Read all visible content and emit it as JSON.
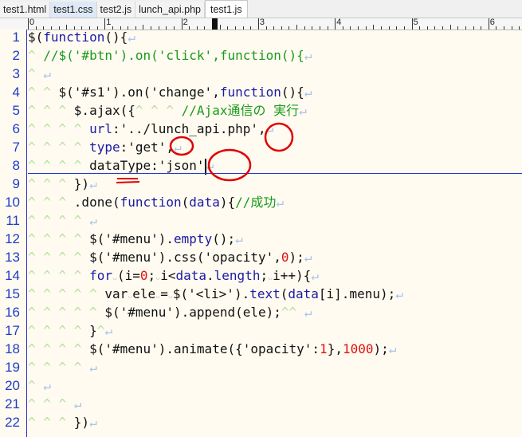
{
  "tabs": [
    {
      "label": "test1.html",
      "state": "normal"
    },
    {
      "label": "test1.css",
      "state": "hl"
    },
    {
      "label": "test2.js",
      "state": "normal"
    },
    {
      "label": "lunch_api.php",
      "state": "normal"
    },
    {
      "label": "test1.js",
      "state": "active"
    }
  ],
  "ruler": {
    "labels": [
      "0",
      "1",
      "2",
      "3",
      "4",
      "5",
      "6"
    ],
    "cursor_column": 24
  },
  "annotation_color": "#e00000",
  "lines": [
    [
      [
        "",
        "$("
      ],
      [
        "k",
        "function"
      ],
      [
        "",
        "(){"
      ],
      [
        "e",
        "↵"
      ]
    ],
    [
      [
        "t",
        "^ "
      ],
      [
        "c",
        "//$('#btn').on('click',function(){"
      ],
      [
        "e",
        "↵"
      ]
    ],
    [
      [
        "t",
        "^ "
      ],
      [
        "e",
        "↵"
      ]
    ],
    [
      [
        "t",
        "^ ^ "
      ],
      [
        "",
        "$('#s1').on('change',"
      ],
      [
        "k",
        "function"
      ],
      [
        "",
        "(){"
      ],
      [
        "e",
        "↵"
      ]
    ],
    [
      [
        "t",
        "^ ^ ^ "
      ],
      [
        "",
        "$.ajax({"
      ],
      [
        "t",
        "^ ^ ^ "
      ],
      [
        "c",
        "//Ajax通信の 実行"
      ],
      [
        "e",
        "↵"
      ]
    ],
    [
      [
        "t",
        "^ ^ ^ ^ "
      ],
      [
        "k",
        "url"
      ],
      [
        "",
        ":'../lunch_api.php',"
      ],
      [
        "e",
        "↵"
      ]
    ],
    [
      [
        "t",
        "^ ^ ^ ^ "
      ],
      [
        "k",
        "type"
      ],
      [
        "",
        ":'get',"
      ],
      [
        "e",
        "↵"
      ]
    ],
    [
      [
        "t",
        "^ ^ ^ ^ "
      ],
      [
        "",
        "dataType:'json'"
      ],
      [
        "cur",
        ""
      ],
      [
        "e",
        "↵"
      ]
    ],
    [
      [
        "t",
        "^ ^ ^ "
      ],
      [
        "",
        "})"
      ],
      [
        "e",
        "↵"
      ]
    ],
    [
      [
        "t",
        "^ ^ ^ "
      ],
      [
        "",
        ".done("
      ],
      [
        "k",
        "function"
      ],
      [
        "",
        "("
      ],
      [
        "k",
        "data"
      ],
      [
        "",
        "){"
      ],
      [
        "c",
        "//成功"
      ],
      [
        "e",
        "↵"
      ]
    ],
    [
      [
        "t",
        "^ ^ ^ ^ "
      ],
      [
        "e",
        "↵"
      ]
    ],
    [
      [
        "t",
        "^ ^ ^ ^ "
      ],
      [
        "",
        "$('#menu')."
      ],
      [
        "k",
        "empty"
      ],
      [
        "",
        "();"
      ],
      [
        "e",
        "↵"
      ]
    ],
    [
      [
        "t",
        "^ ^ ^ ^ "
      ],
      [
        "",
        "$('#menu').css('opacity',"
      ],
      [
        "n",
        "0"
      ],
      [
        "",
        ");"
      ],
      [
        "e",
        "↵"
      ]
    ],
    [
      [
        "t",
        "^ ^ ^ ^ "
      ],
      [
        "k",
        "for"
      ],
      [
        "s",
        "ᴗ"
      ],
      [
        "",
        "(i="
      ],
      [
        "n",
        "0"
      ],
      [
        "",
        ";"
      ],
      [
        "s",
        "ᴗ"
      ],
      [
        "",
        "i<"
      ],
      [
        "k",
        "data"
      ],
      [
        "",
        "."
      ],
      [
        "k",
        "length"
      ],
      [
        "",
        ";"
      ],
      [
        "s",
        "ᴗ"
      ],
      [
        "",
        "i++){"
      ],
      [
        "e",
        "↵"
      ]
    ],
    [
      [
        "t",
        "^ ^ ^ ^ ^ "
      ],
      [
        "",
        "var"
      ],
      [
        "s",
        "ᴗ"
      ],
      [
        "",
        "ele"
      ],
      [
        "s",
        "ᴗ"
      ],
      [
        "",
        "="
      ],
      [
        "s",
        "ᴗ"
      ],
      [
        "",
        "$('<li>')."
      ],
      [
        "k",
        "text"
      ],
      [
        "",
        "("
      ],
      [
        "k",
        "data"
      ],
      [
        "",
        "[i].menu);"
      ],
      [
        "e",
        "↵"
      ]
    ],
    [
      [
        "t",
        "^ ^ ^ ^ ^ "
      ],
      [
        "",
        "$('#menu').append(ele);"
      ],
      [
        "t",
        "^^ "
      ],
      [
        "e",
        "↵"
      ]
    ],
    [
      [
        "t",
        "^ ^ ^ ^ "
      ],
      [
        "",
        "}"
      ],
      [
        "t",
        "^"
      ],
      [
        "e",
        "↵"
      ]
    ],
    [
      [
        "t",
        "^ ^ ^ ^ "
      ],
      [
        "",
        "$('#menu').animate({'opacity':"
      ],
      [
        "n",
        "1"
      ],
      [
        "",
        "},"
      ],
      [
        "n",
        "1000"
      ],
      [
        "",
        ");"
      ],
      [
        "e",
        "↵"
      ]
    ],
    [
      [
        "t",
        "^ ^ ^ ^ "
      ],
      [
        "e",
        "↵"
      ]
    ],
    [
      [
        "t",
        "^ "
      ],
      [
        "e",
        "↵"
      ]
    ],
    [
      [
        "t",
        "^ ^ ^ "
      ],
      [
        "e",
        "↵"
      ]
    ],
    [
      [
        "t",
        "^ ^ ^ "
      ],
      [
        "",
        "})"
      ],
      [
        "e",
        "↵"
      ]
    ]
  ]
}
